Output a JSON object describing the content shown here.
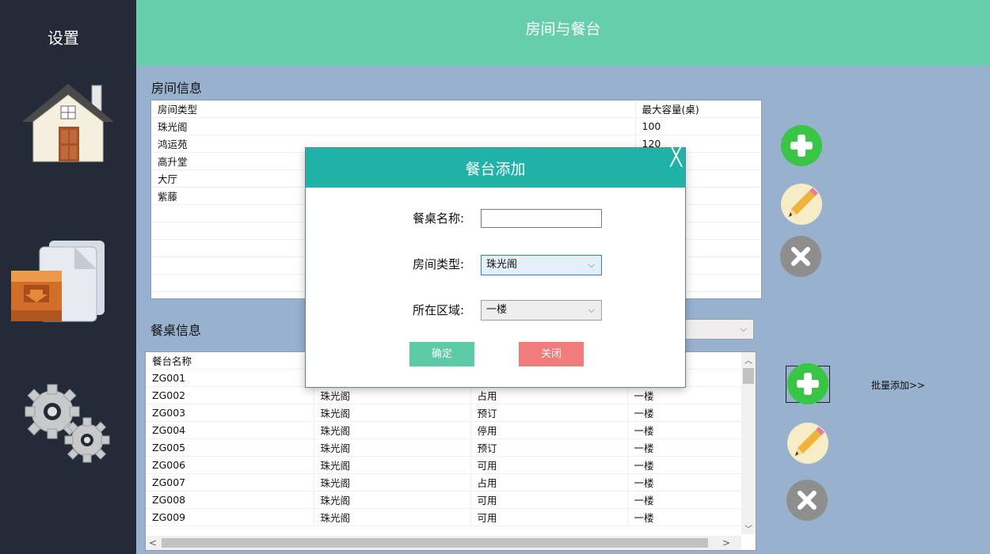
{
  "sidebar": {
    "title": "设置"
  },
  "header": {
    "title": "房间与餐台"
  },
  "room_section": {
    "label": "房间信息",
    "columns": [
      "房间类型",
      "最大容量(桌)"
    ],
    "rows": [
      [
        "珠光阁",
        "100"
      ],
      [
        "鸿运苑",
        "120"
      ],
      [
        "高升堂",
        ""
      ],
      [
        "大厅",
        ""
      ],
      [
        "紫藤",
        ""
      ]
    ]
  },
  "table_section": {
    "label": "餐桌信息",
    "columns": [
      "餐台名称",
      "",
      "",
      ""
    ],
    "rows": [
      [
        "ZG001",
        "",
        "",
        ""
      ],
      [
        "ZG002",
        "珠光阁",
        "占用",
        "一楼"
      ],
      [
        "ZG003",
        "珠光阁",
        "预订",
        "一楼"
      ],
      [
        "ZG004",
        "珠光阁",
        "停用",
        "一楼"
      ],
      [
        "ZG005",
        "珠光阁",
        "预订",
        "一楼"
      ],
      [
        "ZG006",
        "珠光阁",
        "可用",
        "一楼"
      ],
      [
        "ZG007",
        "珠光阁",
        "占用",
        "一楼"
      ],
      [
        "ZG008",
        "珠光阁",
        "可用",
        "一楼"
      ],
      [
        "ZG009",
        "珠光阁",
        "可用",
        "一楼"
      ]
    ],
    "batch_add_label": "批量添加>>"
  },
  "modal": {
    "title": "餐台添加",
    "close_glyph": "╳",
    "name_label": "餐桌名称:",
    "name_value": "",
    "room_type_label": "房间类型:",
    "room_type_value": "珠光阁",
    "area_label": "所在区域:",
    "area_value": "一楼",
    "confirm_label": "确定",
    "close_label": "关闭"
  },
  "icons": {
    "sidebar": [
      "house-icon",
      "archive-icon",
      "gears-icon"
    ],
    "actions": [
      "add-icon",
      "edit-icon",
      "delete-icon"
    ]
  },
  "colors": {
    "sidebar_bg": "#242a38",
    "header_bg": "#66ceaa",
    "content_bg": "#98b1cf",
    "modal_header": "#20b2a7",
    "confirm_button": "#5ccba5",
    "close_button": "#f07c7c",
    "add_icon": "#39c645"
  }
}
